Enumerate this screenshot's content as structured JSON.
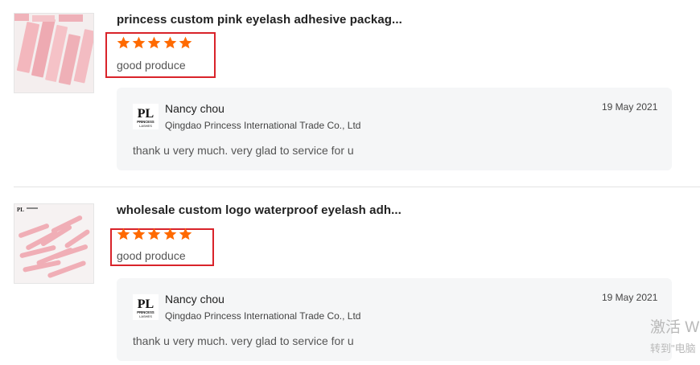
{
  "reviews": [
    {
      "title": "princess custom pink eyelash adhesive packag...",
      "rating": 5,
      "text": "good produce",
      "reply": {
        "logo": "princess-lashes-logo",
        "logo_text": "PL PRINCESS LASHES",
        "name": "Nancy chou",
        "company": "Qingdao Princess International Trade Co., Ltd",
        "date": "19 May 2021",
        "message": "thank u very much.  very glad to service for u"
      }
    },
    {
      "title": "wholesale custom logo waterproof eyelash adh...",
      "rating": 5,
      "text": "good produce",
      "reply": {
        "logo": "princess-lashes-logo",
        "logo_text": "PL PRINCESS LASHES",
        "name": "Nancy chou",
        "company": "Qingdao Princess International Trade Co., Ltd",
        "date": "19 May 2021",
        "message": "thank u very much.  very glad to service for u"
      }
    }
  ],
  "watermark": {
    "line1": "激活 W",
    "line2": "转到\"电脑"
  },
  "colors": {
    "star": "#ff6a00",
    "highlight_box": "#d9232a",
    "reply_bg": "#f5f6f7",
    "product_pink": "#f2b8bf"
  }
}
